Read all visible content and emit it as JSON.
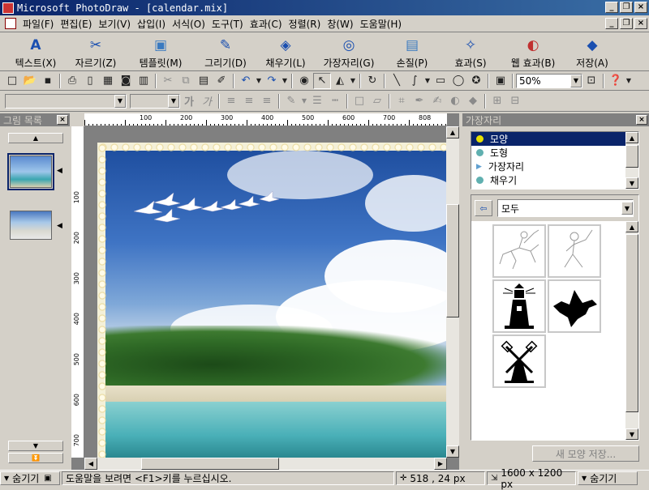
{
  "window": {
    "title": "Microsoft PhotoDraw - [calendar.mix]"
  },
  "menu": [
    "파일(F)",
    "편집(E)",
    "보기(V)",
    "삽입(I)",
    "서식(O)",
    "도구(T)",
    "효과(C)",
    "정렬(R)",
    "창(W)",
    "도움말(H)"
  ],
  "big_toolbar": [
    {
      "label": "텍스트(X)",
      "icon": "text-icon"
    },
    {
      "label": "자르기(Z)",
      "icon": "scissors-icon"
    },
    {
      "label": "템플릿(M)",
      "icon": "template-icon"
    },
    {
      "label": "그리기(D)",
      "icon": "draw-icon"
    },
    {
      "label": "채우기(L)",
      "icon": "fill-icon"
    },
    {
      "label": "가장자리(G)",
      "icon": "edge-icon"
    },
    {
      "label": "손질(P)",
      "icon": "touchup-icon"
    },
    {
      "label": "효과(S)",
      "icon": "effects-icon"
    },
    {
      "label": "웹 효과(B)",
      "icon": "web-effects-icon"
    },
    {
      "label": "저장(A)",
      "icon": "save-icon"
    }
  ],
  "zoom": "50%",
  "left_panel": {
    "title": "그림 목록"
  },
  "ruler": {
    "top": [
      "100",
      "200",
      "300",
      "400",
      "500",
      "600",
      "700",
      "808"
    ],
    "left": [
      "100",
      "200",
      "300",
      "400",
      "500",
      "600",
      "700"
    ]
  },
  "right_panel": {
    "title": "가장자리",
    "categories": [
      "모양",
      "도형",
      "가장자리",
      "채우기"
    ],
    "category_colors": [
      "#e8e000",
      "#60b0b0",
      "#60a0d0",
      "#60b0b0"
    ],
    "filter": "모두",
    "save_button": "새 모양 저장..."
  },
  "status": {
    "hide_left": "숨기기",
    "help": "도움말을 보려면 <F1>키를 누르십시오.",
    "coords": "518 , 24  px",
    "size": "1600 x 1200  px",
    "hide_right": "숨기기"
  }
}
